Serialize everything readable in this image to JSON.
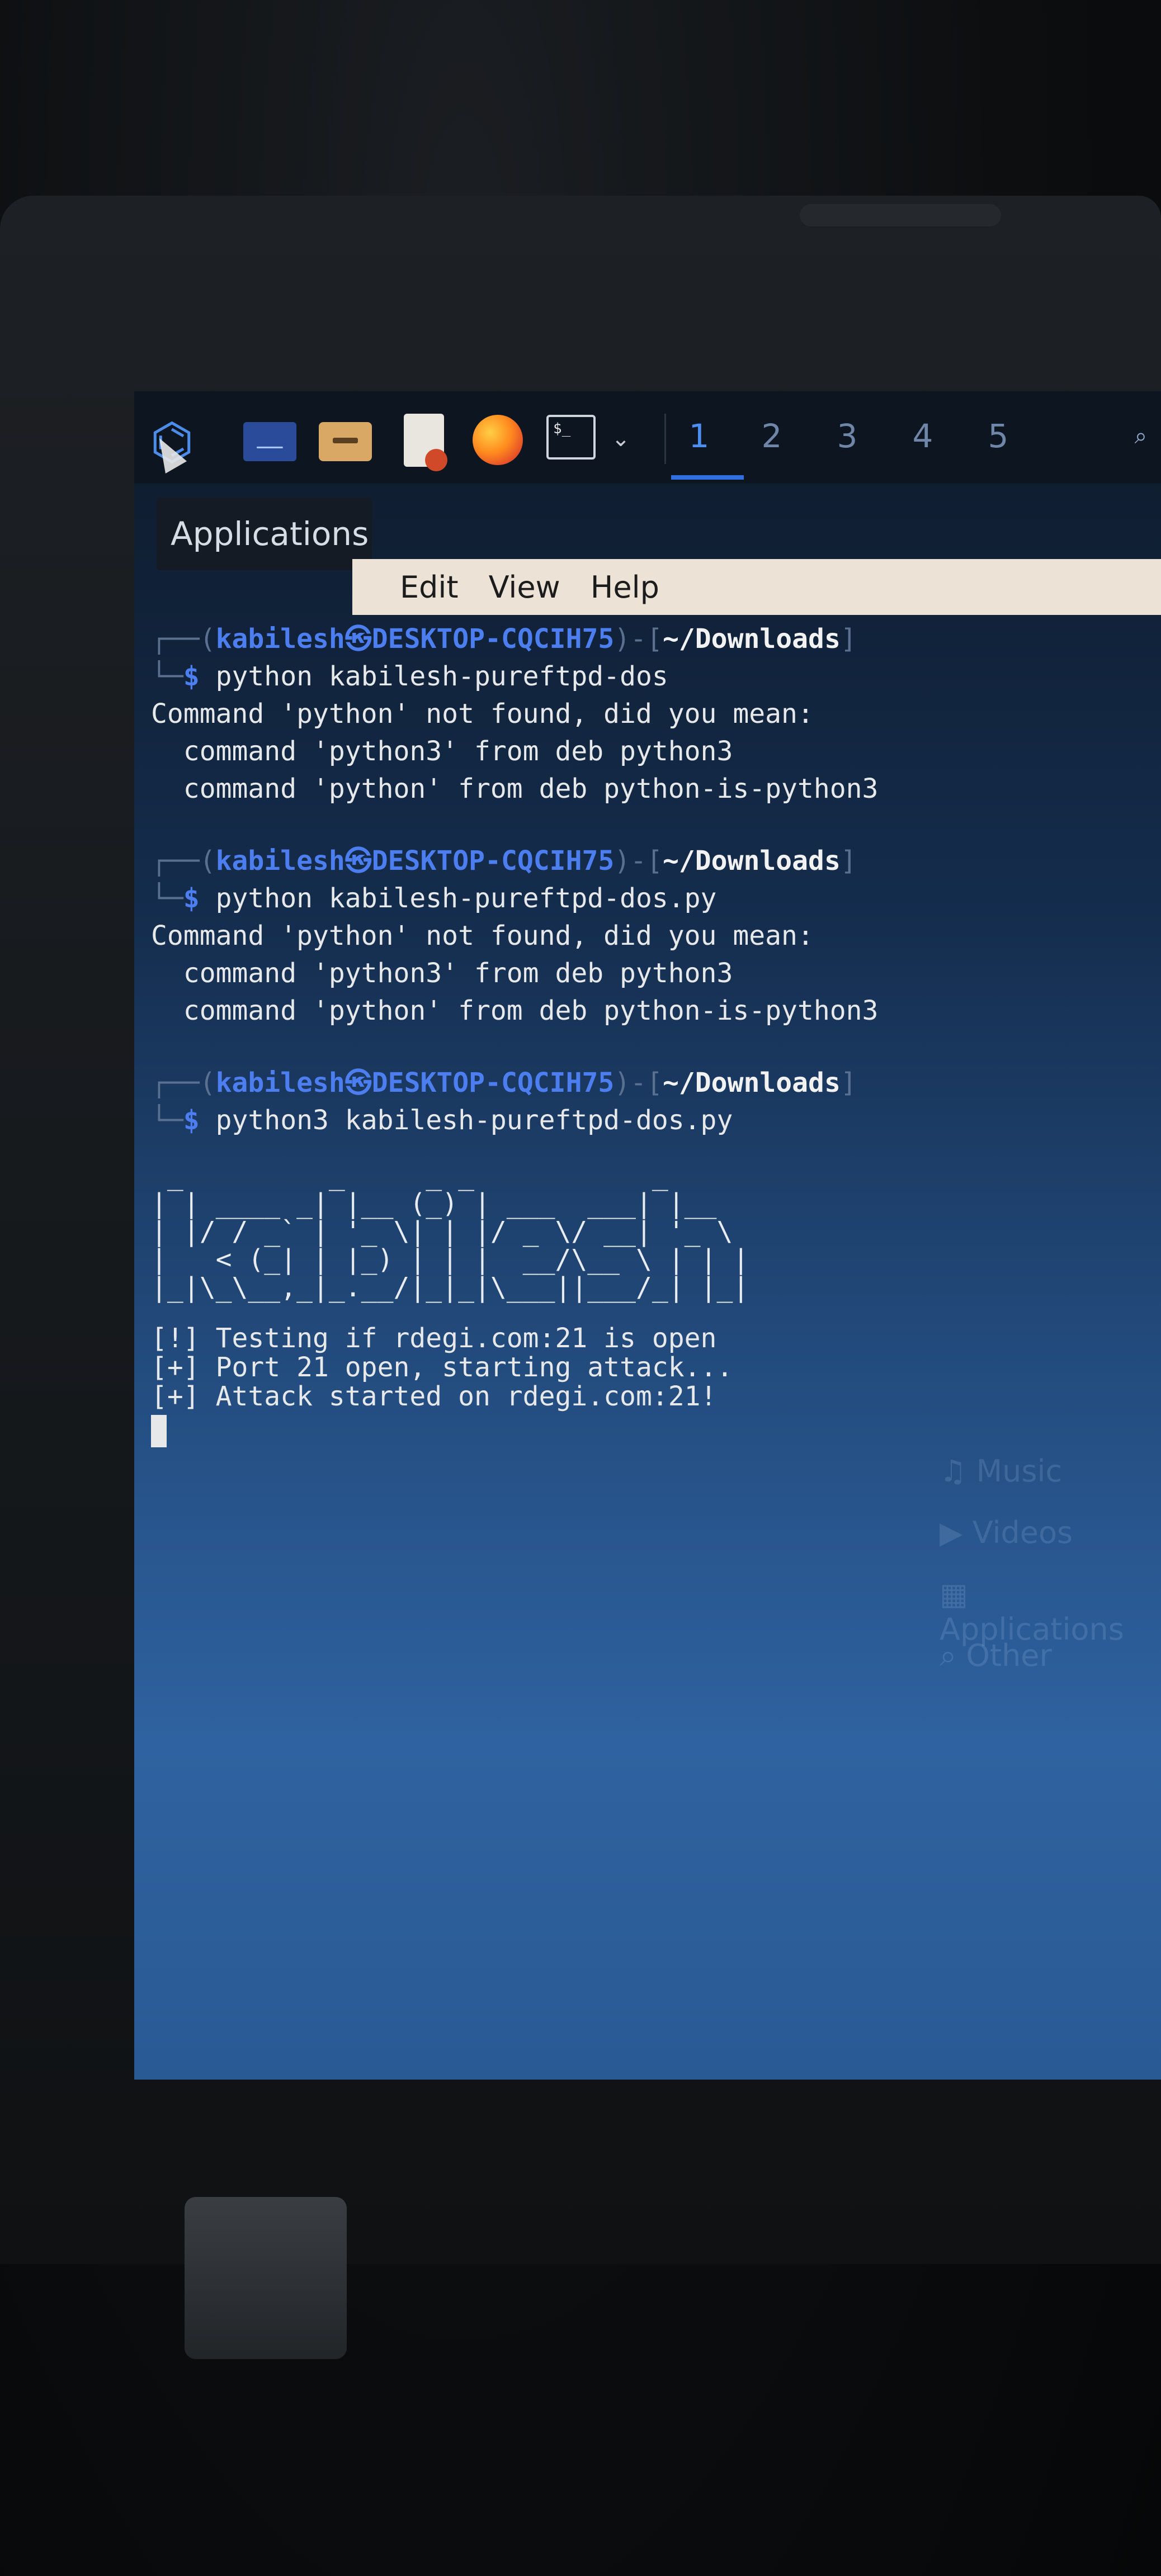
{
  "panel": {
    "icons": [
      "kali-dragon-icon",
      "desktop-icon",
      "folder-icon",
      "text-editor-icon",
      "firefox-icon",
      "terminal-icon"
    ],
    "workspaces": [
      "1",
      "2",
      "3",
      "4",
      "5"
    ],
    "active_workspace": "1",
    "terminal_glyph": "$_",
    "chevron": "⌄",
    "search_glyph": "🔍"
  },
  "applications_tooltip": "Applications",
  "menubar": {
    "items": [
      "Edit",
      "View",
      "Help"
    ]
  },
  "terminal": {
    "prompt": {
      "corner_top": "┌──(",
      "user_host": "kabilesh㉿DESKTOP-CQCIH75",
      "mid": ")-[",
      "path": "~/Downloads",
      "end": "]",
      "corner_bottom": "└─",
      "dollar": "$"
    },
    "commands": [
      {
        "cmd": "python kabilesh-pureftpd-dos",
        "output": [
          "Command 'python' not found, did you mean:",
          "  command 'python3' from deb python3",
          "  command 'python' from deb python-is-python3"
        ]
      },
      {
        "cmd": "python kabilesh-pureftpd-dos.py",
        "output": [
          "Command 'python' not found, did you mean:",
          "  command 'python3' from deb python3",
          "  command 'python' from deb python-is-python3"
        ]
      },
      {
        "cmd": "python3 kabilesh-pureftpd-dos.py",
        "output": []
      }
    ],
    "ascii_banner": [
      " _         _     _ _           _     ",
      "| | ____ _| |__ (_) | ___  ___| |__  ",
      "| |/ / _` | '_ \\| | |/ _ \\/ __| '_ \\ ",
      "|   < (_| | |_) | | |  __/\\__ \\ | | |",
      "|_|\\_\\__,_|_.__/|_|_|\\___||___/_| |_|"
    ],
    "status_lines": [
      "[!] Testing if rdegi.com:21 is open",
      "[+] Port 21 open, starting attack...",
      "[+] Attack started on rdegi.com:21!"
    ]
  },
  "colors": {
    "prompt_blue": "#4c7ef0",
    "menubar_bg": "#ece3d6",
    "panel_bg": "#0d1620"
  }
}
